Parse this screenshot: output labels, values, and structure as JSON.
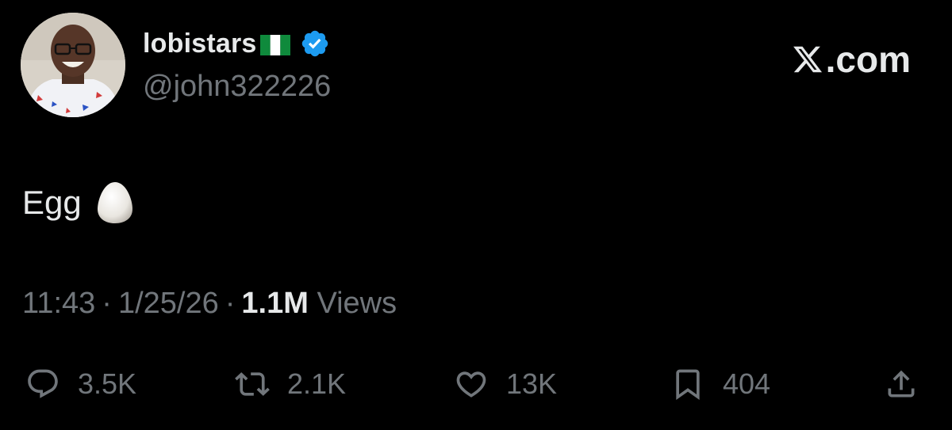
{
  "user": {
    "display_name": "lobistars",
    "flag": "nigeria-flag",
    "verified": true,
    "handle": "@john322226"
  },
  "brand": {
    "label": ".com",
    "logo": "x-logo-icon"
  },
  "tweet": {
    "text": "Egg",
    "emoji": "egg-icon"
  },
  "meta": {
    "time": "11:43",
    "date": "1/25/26",
    "separator": "·",
    "views_count": "1.1M",
    "views_label": "Views"
  },
  "actions": {
    "reply": {
      "icon": "reply-icon",
      "count": "3.5K"
    },
    "repost": {
      "icon": "repost-icon",
      "count": "2.1K"
    },
    "like": {
      "icon": "heart-icon",
      "count": "13K"
    },
    "bookmark": {
      "icon": "bookmark-icon",
      "count": "404"
    },
    "share": {
      "icon": "share-icon"
    }
  },
  "colors": {
    "background": "#000000",
    "primary_text": "#e7e9ea",
    "secondary_text": "#71767b",
    "verified_blue": "#1d9bf0"
  }
}
